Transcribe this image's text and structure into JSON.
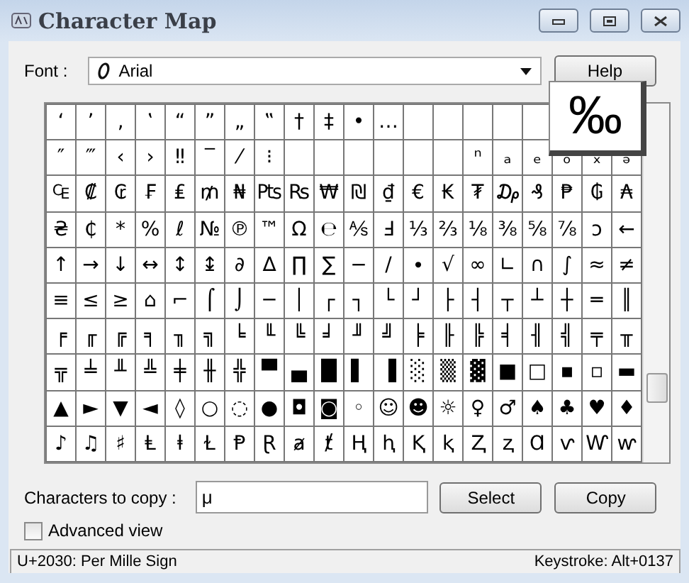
{
  "window": {
    "title": "Character Map"
  },
  "font": {
    "label": "Font :",
    "value": "Arial"
  },
  "help_button": "Help",
  "grid": {
    "rows": [
      [
        "‘",
        "’",
        "‚",
        "‛",
        "“",
        "”",
        "„",
        "‟",
        "†",
        "‡",
        "•",
        "…"
      ],
      [
        "″",
        "‴",
        "‹",
        "›",
        "‼",
        "‾",
        "⁄",
        "⁝",
        null,
        null,
        null,
        null,
        null,
        null,
        "ⁿ",
        "ₐ",
        "ₑ",
        "ₒ",
        "ₓ",
        "ₔ"
      ],
      [
        "₠",
        "₡",
        "₢",
        "₣",
        "₤",
        "₥",
        "₦",
        "₧",
        "₨",
        "₩",
        "₪",
        "₫",
        "€",
        "₭",
        "₮",
        "₯",
        "₰",
        "₱",
        "₲",
        "₳"
      ],
      [
        "₴",
        "₵",
        "*",
        "%",
        "ℓ",
        "№",
        "℗",
        "™",
        "Ω",
        "℮",
        "⅍",
        "Ⅎ",
        "⅓",
        "⅔",
        "⅛",
        "⅜",
        "⅝",
        "⅞",
        "ↄ",
        "←"
      ],
      [
        "↑",
        "→",
        "↓",
        "↔",
        "↕",
        "↨",
        "∂",
        "∆",
        "∏",
        "∑",
        "−",
        "∕",
        "∙",
        "√",
        "∞",
        "∟",
        "∩",
        "∫",
        "≈",
        "≠"
      ],
      [
        "≡",
        "≤",
        "≥",
        "⌂",
        "⌐",
        "⌠",
        "⌡",
        "─",
        "│",
        "┌",
        "┐",
        "└",
        "┘",
        "├",
        "┤",
        "┬",
        "┴",
        "┼",
        "═",
        "║"
      ],
      [
        "╒",
        "╓",
        "╔",
        "╕",
        "╖",
        "╗",
        "╘",
        "╙",
        "╚",
        "╛",
        "╜",
        "╝",
        "╞",
        "╟",
        "╠",
        "╡",
        "╢",
        "╣",
        "╤",
        "╥"
      ],
      [
        "╦",
        "╧",
        "╨",
        "╩",
        "╪",
        "╫",
        "╬",
        "▀",
        "▄",
        "█",
        "▌",
        "▐",
        "░",
        "▒",
        "▓",
        "■",
        "□",
        "▪",
        "▫",
        "▬"
      ],
      [
        "▲",
        "►",
        "▼",
        "◄",
        "◊",
        "○",
        "◌",
        "●",
        "◘",
        "◙",
        "◦",
        "☺",
        "☻",
        "☼",
        "♀",
        "♂",
        "♠",
        "♣",
        "♥",
        "♦"
      ],
      [
        "♪",
        "♫",
        "♯",
        "Ⱡ",
        "ⱡ",
        "Ɫ",
        "Ᵽ",
        "Ɽ",
        "ⱥ",
        "ⱦ",
        "Ⱨ",
        "ⱨ",
        "Ⱪ",
        "ⱪ",
        "Ⱬ",
        "ⱬ",
        "Ɑ",
        "ⱱ",
        "Ⱳ",
        "ⱳ"
      ]
    ],
    "magnified": "‰"
  },
  "copy": {
    "label": "Characters to copy :",
    "value": "μ",
    "buttons": [
      "Select",
      "Copy"
    ]
  },
  "advanced_view": {
    "label": "Advanced view",
    "checked": false
  },
  "status_bar": {
    "description": "U+2030: Per Mille Sign",
    "keystroke": "Keystroke: Alt+0137"
  }
}
